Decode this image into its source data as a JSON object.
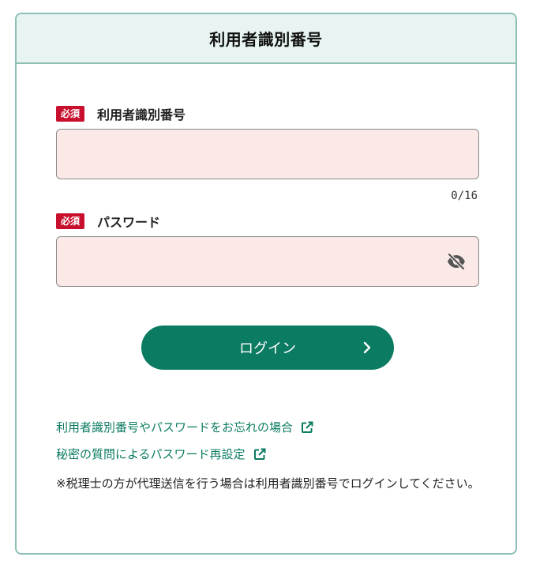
{
  "header": {
    "title": "利用者識別番号"
  },
  "form": {
    "user_id": {
      "required_badge": "必須",
      "label": "利用者識別番号",
      "value": "",
      "counter": "0/16"
    },
    "password": {
      "required_badge": "必須",
      "label": "パスワード",
      "value": "",
      "visibility_icon": "eye-off-icon"
    },
    "login_button": {
      "label": "ログイン",
      "icon": "chevron-right-icon"
    }
  },
  "links": [
    {
      "label": "利用者識別番号やパスワードをお忘れの場合",
      "icon": "external-link-icon"
    },
    {
      "label": "秘密の質問によるパスワード再設定",
      "icon": "external-link-icon"
    }
  ],
  "note": "※税理士の方が代理送信を行う場合は利用者識別番号でログインしてください。",
  "colors": {
    "accent": "#0b7b61",
    "header_bg": "#e7f4f2",
    "border": "#8ebfb6",
    "required_badge": "#c8102e",
    "input_bg": "#fbe9e8"
  }
}
